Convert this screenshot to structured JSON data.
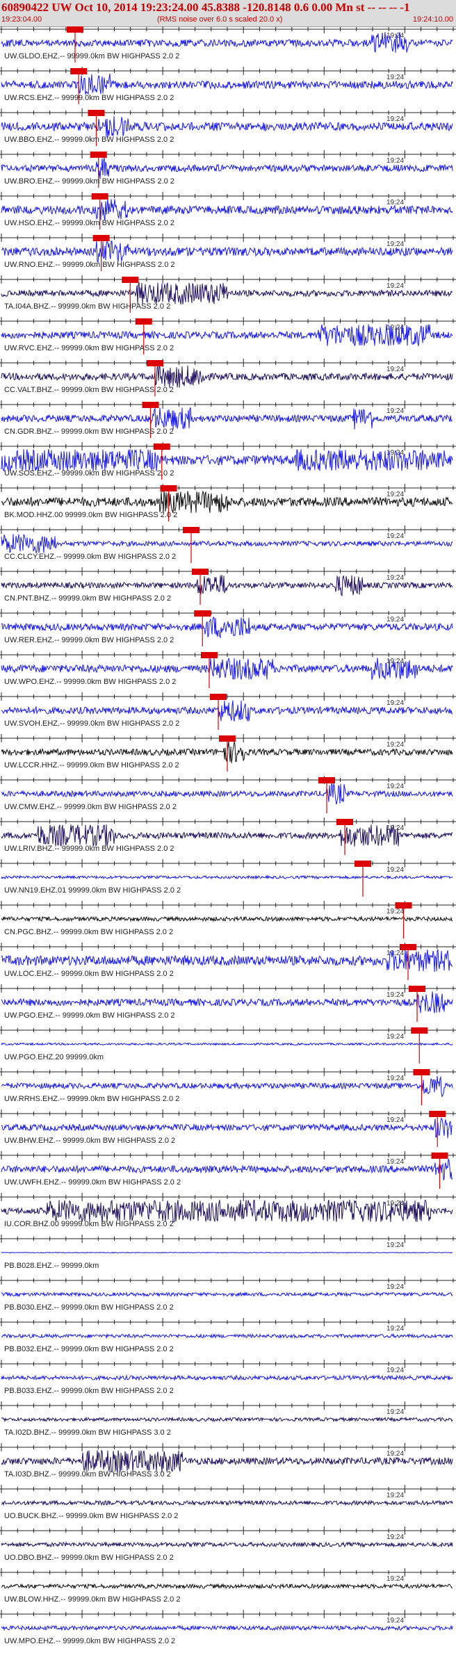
{
  "header": {
    "title": "60890422 UW Oct 10, 2014 19:23:24.00   45.8388 -120.8148  0.6 0.00 Mn st -- -- --  -1",
    "start_time": "19:23:04.00",
    "subtitle": "(RMS noise over 6.0 s scaled 20.0 x)",
    "end_time": "19:24:10.00"
  },
  "colors": {
    "trace_blue": "#1a1aee",
    "trace_dark": "#201060",
    "trace_black": "#111111",
    "pick_red": "#dd0000",
    "header_bg": "#dcdcdc"
  },
  "chart_data": {
    "type": "seismogram",
    "minute_label": "19:24",
    "traces": [
      {
        "label": "UW.GLDO.EHZ.-- 99999.0km BW  HIGHPASS  2.0  2",
        "pick": 0.163,
        "color": "blue",
        "amp": 0.5,
        "bursts": [
          [
            0.82,
            0.9
          ]
        ]
      },
      {
        "label": "UW.RCS.EHZ.-- 99999.0km BW  HIGHPASS  2.0  2",
        "pick": 0.171,
        "color": "blue",
        "amp": 0.55,
        "bursts": [
          [
            0.17,
            0.24
          ]
        ]
      },
      {
        "label": "UW.BBO.EHZ.-- 99999.0km BW  HIGHPASS  2.0  2",
        "pick": 0.21,
        "color": "blue",
        "amp": 0.6,
        "bursts": [
          [
            0.21,
            0.28
          ]
        ]
      },
      {
        "label": "UW.BRO.EHZ.-- 99999.0km BW  HIGHPASS  2.0  2",
        "pick": 0.215,
        "color": "blue",
        "amp": 0.5,
        "bursts": [
          [
            0.21,
            0.24
          ]
        ]
      },
      {
        "label": "UW.HSO.EHZ.-- 99999.0km BW  HIGHPASS  2.0  2",
        "pick": 0.218,
        "color": "blue",
        "amp": 0.6,
        "bursts": [
          [
            0.21,
            0.28
          ]
        ]
      },
      {
        "label": "UW.RNO.EHZ.-- 99999.0km BW  HIGHPASS  2.0  2",
        "pick": 0.221,
        "color": "blue",
        "amp": 0.6,
        "bursts": [
          [
            0.21,
            0.28
          ]
        ]
      },
      {
        "label": "TA.I04A.BHZ.-- 99999.0km BW  HIGHPASS  2.0  2",
        "pick": 0.285,
        "color": "dark",
        "amp": 0.45,
        "bursts": [
          [
            0.3,
            0.5
          ]
        ]
      },
      {
        "label": "UW.RVC.EHZ.-- 99999.0km BW  HIGHPASS  2.0  2",
        "pick": 0.315,
        "color": "blue",
        "amp": 0.5,
        "bursts": [
          [
            0.7,
            0.95
          ]
        ]
      },
      {
        "label": "CC.VALT.BHZ.-- 99999.0km BW  HIGHPASS  2.0  2",
        "pick": 0.34,
        "color": "dark",
        "amp": 0.5,
        "bursts": [
          [
            0.34,
            0.45
          ]
        ]
      },
      {
        "label": "CN.GDR.BHZ.-- 99999.0km BW  HIGHPASS  2.0  2",
        "pick": 0.33,
        "color": "blue",
        "amp": 0.5,
        "bursts": [
          [
            0.33,
            0.42
          ],
          [
            0.78,
            0.82
          ]
        ]
      },
      {
        "label": "UW.SOS.EHZ.-- 99999.0km BW  HIGHPASS  2.0  2",
        "pick": 0.355,
        "color": "blue",
        "amp": 0.7,
        "bursts": [
          [
            0.0,
            0.35
          ],
          [
            0.65,
            0.98
          ]
        ]
      },
      {
        "label": "BK.MOD.HHZ.00 99999.0km BW  HIGHPASS  2.0  2",
        "pick": 0.37,
        "color": "black",
        "amp": 0.65,
        "bursts": [
          [
            0.35,
            0.5
          ]
        ]
      },
      {
        "label": "CC.CLCY.EHZ.-- 99999.0km BW  HIGHPASS  2.0  2",
        "pick": 0.42,
        "color": "blue",
        "amp": 0.35,
        "bursts": [
          [
            0.0,
            0.12
          ]
        ]
      },
      {
        "label": "CN.PNT.BHZ.-- 99999.0km BW  HIGHPASS  2.0  2",
        "pick": 0.44,
        "color": "dark",
        "amp": 0.4,
        "bursts": [
          [
            0.43,
            0.5
          ],
          [
            0.74,
            0.8
          ]
        ]
      },
      {
        "label": "UW.RER.EHZ.-- 99999.0km BW  HIGHPASS  2.0  2",
        "pick": 0.445,
        "color": "blue",
        "amp": 0.5,
        "bursts": [
          [
            0.45,
            0.55
          ]
        ]
      },
      {
        "label": "UW.WPO.EHZ.-- 99999.0km BW  HIGHPASS  2.0  2",
        "pick": 0.46,
        "color": "blue",
        "amp": 0.55,
        "bursts": [
          [
            0.46,
            0.6
          ],
          [
            0.82,
            0.92
          ]
        ]
      },
      {
        "label": "UW.SVOH.EHZ.-- 99999.0km BW  HIGHPASS  2.0  2",
        "pick": 0.48,
        "color": "blue",
        "amp": 0.5,
        "bursts": [
          [
            0.48,
            0.55
          ]
        ]
      },
      {
        "label": "UW.LCCR.HHZ.-- 99999.0km BW  HIGHPASS  2.0  2",
        "pick": 0.5,
        "color": "black",
        "amp": 0.45,
        "bursts": [
          [
            0.49,
            0.54
          ]
        ]
      },
      {
        "label": "UW.CMW.EHZ.-- 99999.0km BW  HIGHPASS  2.0  2",
        "pick": 0.72,
        "color": "blue",
        "amp": 0.4,
        "bursts": [
          [
            0.72,
            0.76
          ]
        ]
      },
      {
        "label": "UW.LRIV.BHZ.-- 99999.0km BW  HIGHPASS  2.0  2",
        "pick": 0.76,
        "color": "dark",
        "amp": 0.45,
        "bursts": [
          [
            0.75,
            0.88
          ],
          [
            0.08,
            0.25
          ]
        ]
      },
      {
        "label": "UW.NN19.EHZ.01 99999.0km BW  HIGHPASS  2.0  2",
        "pick": 0.8,
        "color": "blue",
        "amp": 0.2,
        "bursts": []
      },
      {
        "label": "CN.PGC.BHZ.-- 99999.0km BW  HIGHPASS  2.0  2",
        "pick": 0.89,
        "color": "black",
        "amp": 0.3,
        "bursts": []
      },
      {
        "label": "UW.LOC.EHZ.-- 99999.0km BW  HIGHPASS  2.0  2",
        "pick": 0.9,
        "color": "blue",
        "amp": 0.7,
        "bursts": [
          [
            0.85,
            1.0
          ]
        ]
      },
      {
        "label": "UW.PGO.EHZ.-- 99999.0km BW  HIGHPASS  2.0  2",
        "pick": 0.92,
        "color": "blue",
        "amp": 0.5,
        "bursts": [
          [
            0.92,
            0.98
          ]
        ]
      },
      {
        "label": "UW.PGO.EHZ.20 99999.0km",
        "pick": 0.925,
        "color": "blue",
        "amp": 0.15,
        "bursts": []
      },
      {
        "label": "UW.RRHS.EHZ.-- 99999.0km BW  HIGHPASS  2.0  2",
        "pick": 0.93,
        "color": "blue",
        "amp": 0.4,
        "bursts": [
          [
            0.93,
            0.98
          ]
        ]
      },
      {
        "label": "UW.BHW.EHZ.-- 99999.0km BW  HIGHPASS  2.0  2",
        "pick": 0.965,
        "color": "blue",
        "amp": 0.45,
        "bursts": [
          [
            0.96,
            1.0
          ]
        ]
      },
      {
        "label": "UW.UWFH.EHZ.-- 99999.0km BW  HIGHPASS  2.0  2",
        "pick": 0.97,
        "color": "blue",
        "amp": 0.5,
        "bursts": [
          [
            0.96,
            1.0
          ]
        ]
      },
      {
        "label": "IU.COR.BHZ.00 99999.0km BW  HIGHPASS  2.0  2",
        "pick": null,
        "color": "dark",
        "amp": 0.45,
        "bursts": [
          [
            0.1,
            0.95
          ]
        ]
      },
      {
        "label": "PB.B028.EHZ.-- 99999.0km",
        "pick": null,
        "color": "blue",
        "amp": 0.05,
        "bursts": []
      },
      {
        "label": "PB.B030.EHZ.-- 99999.0km BW  HIGHPASS  2.0  2",
        "pick": null,
        "color": "blue",
        "amp": 0.25,
        "bursts": []
      },
      {
        "label": "PB.B032.EHZ.-- 99999.0km BW  HIGHPASS  2.0  2",
        "pick": null,
        "color": "blue",
        "amp": 0.25,
        "bursts": []
      },
      {
        "label": "PB.B033.EHZ.-- 99999.0km BW  HIGHPASS  2.0  2",
        "pick": null,
        "color": "blue",
        "amp": 0.3,
        "bursts": []
      },
      {
        "label": "TA.I02D.BHZ.-- 99999.0km BW  HIGHPASS  3.0  2",
        "pick": null,
        "color": "dark",
        "amp": 0.25,
        "bursts": []
      },
      {
        "label": "TA.I03D.BHZ.-- 99999.0km BW  HIGHPASS  3.0  2",
        "pick": null,
        "color": "dark",
        "amp": 0.5,
        "bursts": [
          [
            0.18,
            0.4
          ]
        ]
      },
      {
        "label": "UO.BUCK.BHZ.-- 99999.0km BW  HIGHPASS  2.0  2",
        "pick": null,
        "color": "dark",
        "amp": 0.3,
        "bursts": []
      },
      {
        "label": "UO.DBO.BHZ.-- 99999.0km BW  HIGHPASS  2.0  2",
        "pick": null,
        "color": "dark",
        "amp": 0.3,
        "bursts": []
      },
      {
        "label": "UW.BLOW.HHZ.-- 99999.0km BW  HIGHPASS  2.0  2",
        "pick": null,
        "color": "black",
        "amp": 0.3,
        "bursts": []
      },
      {
        "label": "UW.MPO.EHZ.-- 99999.0km BW  HIGHPASS  2.0  2",
        "pick": null,
        "color": "blue",
        "amp": 0.3,
        "bursts": []
      }
    ]
  }
}
